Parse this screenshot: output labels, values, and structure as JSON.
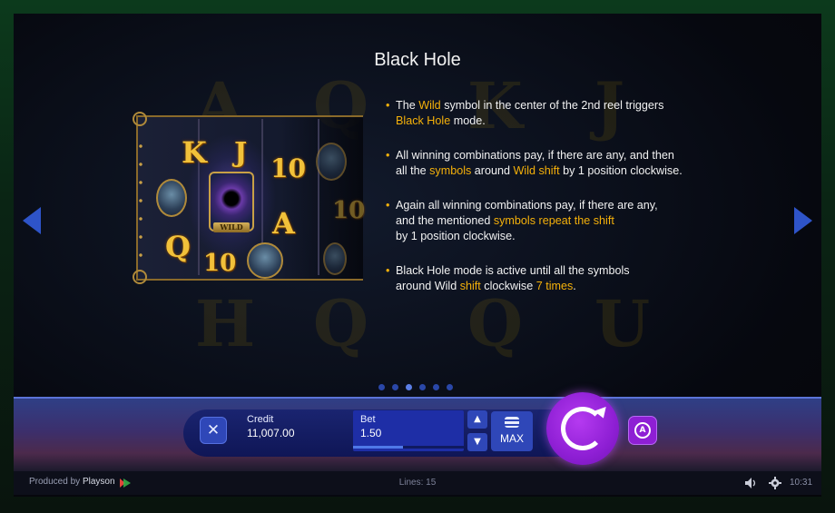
{
  "page": {
    "title": "Black Hole"
  },
  "reel_preview": {
    "symbols": [
      "K",
      "J",
      "10",
      "A",
      "Q",
      "10",
      "10"
    ],
    "wild_label": "WILD"
  },
  "rules": [
    {
      "segments": [
        {
          "text": "The ",
          "hl": false
        },
        {
          "text": "Wild",
          "hl": true
        },
        {
          "text": " symbol in the center of the 2nd reel triggers",
          "hl": false
        },
        {
          "text": "\n",
          "hl": false
        },
        {
          "text": "Black Hole",
          "hl": true
        },
        {
          "text": " mode.",
          "hl": false
        }
      ]
    },
    {
      "segments": [
        {
          "text": "All winning combinations pay, if there are any, and then",
          "hl": false
        },
        {
          "text": "\n",
          "hl": false
        },
        {
          "text": "all the ",
          "hl": false
        },
        {
          "text": "symbols",
          "hl": true
        },
        {
          "text": " around ",
          "hl": false
        },
        {
          "text": "Wild shift",
          "hl": true
        },
        {
          "text": " by 1 position clockwise.",
          "hl": false
        }
      ]
    },
    {
      "segments": [
        {
          "text": "Again all winning combinations pay, if there are any,",
          "hl": false
        },
        {
          "text": "\n",
          "hl": false
        },
        {
          "text": "and the mentioned ",
          "hl": false
        },
        {
          "text": "symbols repeat the shift",
          "hl": true
        },
        {
          "text": "\n",
          "hl": false
        },
        {
          "text": "by 1 position clockwise.",
          "hl": false
        }
      ]
    },
    {
      "segments": [
        {
          "text": "Black Hole mode is active until all the symbols",
          "hl": false
        },
        {
          "text": "\n",
          "hl": false
        },
        {
          "text": "around Wild ",
          "hl": false
        },
        {
          "text": "shift",
          "hl": true
        },
        {
          "text": " clockwise ",
          "hl": false
        },
        {
          "text": "7 times",
          "hl": true
        },
        {
          "text": ".",
          "hl": false
        }
      ]
    }
  ],
  "pager": {
    "count": 6,
    "active_index": 2
  },
  "controls": {
    "close_icon": "close-icon",
    "close_glyph": "✕",
    "credit_label": "Credit",
    "credit_value": "11,007.00",
    "bet_label": "Bet",
    "bet_value": "1.50",
    "bet_level_fraction": 0.45,
    "bet_up_glyph": "▲",
    "bet_down_glyph": "▼",
    "max_label": "MAX",
    "spin_icon": "spin-icon",
    "autoplay_glyph": "A"
  },
  "footer": {
    "produced_by": "Produced by",
    "brand": "Playson",
    "lines": "Lines: 15",
    "time": "10:31"
  },
  "colors": {
    "highlight": "#f5b10a",
    "accent_blue": "#2e54c9",
    "spin_purple": "#8e1fd4"
  }
}
